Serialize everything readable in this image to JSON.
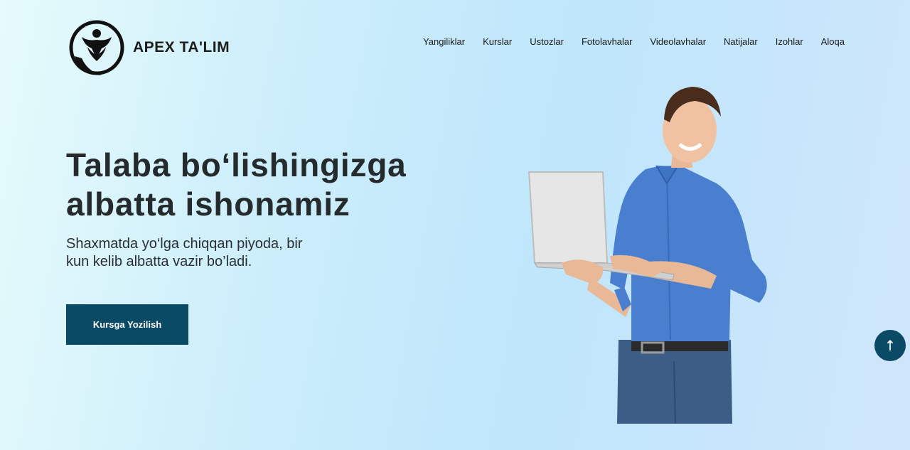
{
  "brand": {
    "name": "APEX TA'LIM",
    "logo_icon": "lotus-person-logo"
  },
  "nav": {
    "items": [
      {
        "label": "Yangiliklar"
      },
      {
        "label": "Kurslar"
      },
      {
        "label": "Ustozlar"
      },
      {
        "label": "Fotolavhalar"
      },
      {
        "label": "Videolavhalar"
      },
      {
        "label": "Natijalar"
      },
      {
        "label": "Izohlar"
      },
      {
        "label": "Aloqa"
      }
    ]
  },
  "hero": {
    "title": "Talaba bo‘lishingizga albatta ishonamiz",
    "subtitle": "Shaxmatda yo‘lga chiqqan piyoda, bir kun kelib albatta vazir bo’ladi.",
    "cta_label": "Kursga Yozilish"
  },
  "scroll_top": {
    "icon": "arrow-up-icon",
    "glyph": "↑"
  },
  "colors": {
    "accent": "#0b4a64",
    "text": "#252a2d"
  }
}
